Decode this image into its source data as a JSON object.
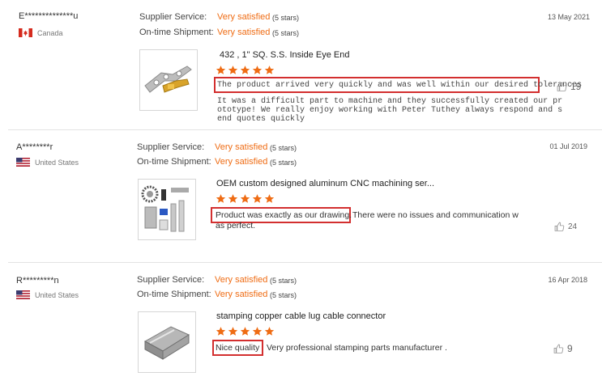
{
  "reviews": [
    {
      "reviewer": "E**************u",
      "country": "Canada",
      "flag": "canada",
      "supplier_service_label": "Supplier Service:",
      "supplier_service_value": "Very satisfied",
      "supplier_service_stars": "(5 stars)",
      "shipment_label": "On-time Shipment:",
      "shipment_value": "Very satisfied",
      "shipment_stars": "(5 stars)",
      "date": "13 May 2021",
      "product_title": "432 , 1\" SQ. S.S. Inside Eye End",
      "rating": 5,
      "highlight_text": "The product arrived very quickly and was well within our desired tolerances",
      "body_lines": [
        "It was a difficult part to machine and they successfully created our pr",
        "ototype! We really enjoy working with Peter Tuthey always respond and s",
        "end quotes quickly"
      ],
      "likes": "19"
    },
    {
      "reviewer": "A********r",
      "country": "United States",
      "flag": "us",
      "supplier_service_label": "Supplier Service:",
      "supplier_service_value": "Very satisfied",
      "supplier_service_stars": "(5 stars)",
      "shipment_label": "On-time Shipment:",
      "shipment_value": "Very satisfied",
      "shipment_stars": "(5 stars)",
      "date": "01 Jul 2019",
      "product_title": "OEM custom designed aluminum CNC machining ser...",
      "rating": 5,
      "highlight_text": "Product was exactly as our drawing.",
      "body_lines": [
        "There were no issues and communication w",
        "as perfect."
      ],
      "likes": "24"
    },
    {
      "reviewer": "R*********n",
      "country": "United States",
      "flag": "us",
      "supplier_service_label": "Supplier Service:",
      "supplier_service_value": "Very satisfied",
      "supplier_service_stars": "(5 stars)",
      "shipment_label": "On-time Shipment:",
      "shipment_value": "Very satisfied",
      "shipment_stars": "(5 stars)",
      "date": "16 Apr 2018",
      "product_title": "stamping copper cable lug cable connector",
      "rating": 5,
      "highlight_text": "Nice quality",
      "body_lines": [
        "Very professional stamping parts manufacturer ."
      ],
      "likes": "9"
    }
  ],
  "colors": {
    "accent": "#ef6c14",
    "highlight": "#d32f2f"
  }
}
